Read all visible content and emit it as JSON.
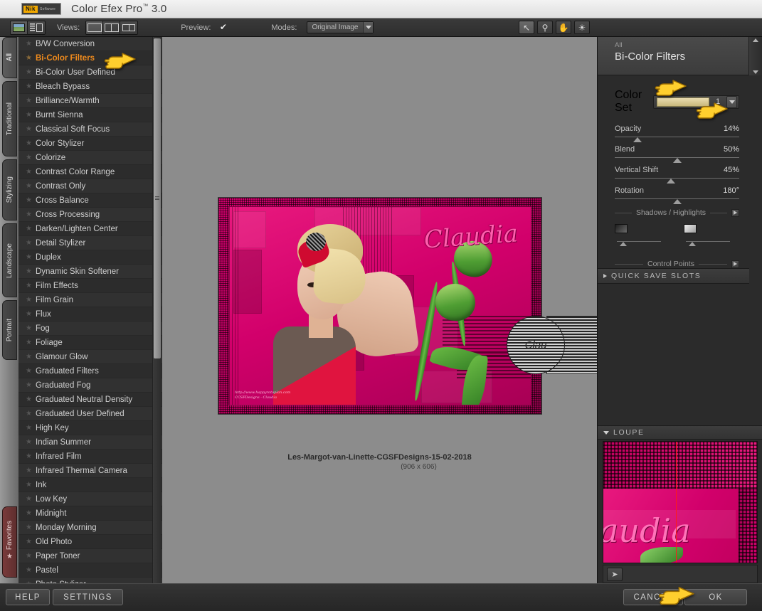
{
  "window": {
    "title": "Color Efex Pro",
    "trademark": "™",
    "version": "3.0",
    "logo_mark": "Nik",
    "logo_sub": "Software"
  },
  "toolbar": {
    "views_label": "Views:",
    "preview_label": "Preview:",
    "preview_checked_glyph": "✔",
    "modes_label": "Modes:",
    "modes_value": "Original Image",
    "view_icons": [
      "image-view-icon",
      "list-view-icon"
    ],
    "view_modes": [
      "single-view-icon",
      "split-view-icon",
      "side-by-side-view-icon"
    ],
    "tools": [
      {
        "name": "cursor-tool",
        "glyph": "↖"
      },
      {
        "name": "zoom-tool",
        "glyph": "⚲"
      },
      {
        "name": "pan-hand-tool",
        "glyph": "✋"
      },
      {
        "name": "brightness-tool",
        "glyph": "☀"
      }
    ]
  },
  "category_tabs": [
    {
      "label": "All",
      "selected": true
    },
    {
      "label": "Traditional",
      "selected": false
    },
    {
      "label": "Stylizing",
      "selected": false
    },
    {
      "label": "Landscape",
      "selected": false
    },
    {
      "label": "Portrait",
      "selected": false
    }
  ],
  "favorites_tab": {
    "label": "Favorites",
    "star_glyph": "★"
  },
  "filters": [
    {
      "label": "B/W Conversion",
      "selected": false
    },
    {
      "label": "Bi-Color Filters",
      "selected": true
    },
    {
      "label": "Bi-Color User Defined",
      "selected": false
    },
    {
      "label": "Bleach Bypass",
      "selected": false
    },
    {
      "label": "Brilliance/Warmth",
      "selected": false
    },
    {
      "label": "Burnt Sienna",
      "selected": false
    },
    {
      "label": "Classical Soft Focus",
      "selected": false
    },
    {
      "label": "Color Stylizer",
      "selected": false
    },
    {
      "label": "Colorize",
      "selected": false
    },
    {
      "label": "Contrast Color Range",
      "selected": false
    },
    {
      "label": "Contrast Only",
      "selected": false
    },
    {
      "label": "Cross Balance",
      "selected": false
    },
    {
      "label": "Cross Processing",
      "selected": false
    },
    {
      "label": "Darken/Lighten Center",
      "selected": false
    },
    {
      "label": "Detail Stylizer",
      "selected": false
    },
    {
      "label": "Duplex",
      "selected": false
    },
    {
      "label": "Dynamic Skin Softener",
      "selected": false
    },
    {
      "label": "Film Effects",
      "selected": false
    },
    {
      "label": "Film Grain",
      "selected": false
    },
    {
      "label": "Flux",
      "selected": false
    },
    {
      "label": "Fog",
      "selected": false
    },
    {
      "label": "Foliage",
      "selected": false
    },
    {
      "label": "Glamour Glow",
      "selected": false
    },
    {
      "label": "Graduated Filters",
      "selected": false
    },
    {
      "label": "Graduated Fog",
      "selected": false
    },
    {
      "label": "Graduated Neutral Density",
      "selected": false
    },
    {
      "label": "Graduated User Defined",
      "selected": false
    },
    {
      "label": "High Key",
      "selected": false
    },
    {
      "label": "Indian Summer",
      "selected": false
    },
    {
      "label": "Infrared Film",
      "selected": false
    },
    {
      "label": "Infrared Thermal Camera",
      "selected": false
    },
    {
      "label": "Ink",
      "selected": false
    },
    {
      "label": "Low Key",
      "selected": false
    },
    {
      "label": "Midnight",
      "selected": false
    },
    {
      "label": "Monday Morning",
      "selected": false
    },
    {
      "label": "Old Photo",
      "selected": false
    },
    {
      "label": "Paper Toner",
      "selected": false
    },
    {
      "label": "Pastel",
      "selected": false
    },
    {
      "label": "Photo Stylizer",
      "selected": false
    }
  ],
  "canvas": {
    "image_caption": "Les-Margot-van-Linette-CGSFDesigns-15-02-2018",
    "image_dimensions": "(906 x 606)",
    "artwork": {
      "script_text": "Claudia",
      "watermark_line1": "http://www.happyrotoplan.com",
      "watermark_line2": "CCSFDesigns - Claudia",
      "stamp_text": "Clau"
    }
  },
  "panel": {
    "category": "All",
    "title": "Bi-Color Filters",
    "color_set": {
      "label": "Color Set",
      "value": "1"
    },
    "sliders": [
      {
        "label": "Opacity",
        "value": "14%",
        "pos_pct": 18
      },
      {
        "label": "Blend",
        "value": "50%",
        "pos_pct": 50
      },
      {
        "label": "Vertical Shift",
        "value": "45%",
        "pos_pct": 45
      },
      {
        "label": "Rotation",
        "value": "180°",
        "pos_pct": 50
      }
    ],
    "shadows_highlights": {
      "title": "Shadows / Highlights",
      "shadow_pos_pct": 8,
      "highlight_pos_pct": 8
    },
    "control_points": {
      "title": "Control Points",
      "remove_glyph": "—",
      "add_glyph": "➕"
    },
    "quick_save_slots": {
      "label": "QUICK SAVE SLOTS",
      "expanded": false
    },
    "loupe": {
      "label": "LOUPE",
      "expanded": true,
      "pin_glyph": "➤"
    }
  },
  "bottom_bar": {
    "help": "HELP",
    "settings": "SETTINGS",
    "cancel": "CANCEL",
    "ok": "OK"
  },
  "colors": {
    "accent_orange": "#f08b1d",
    "cursor_yellow": "#ffcf2e",
    "panel_bg": "#2b2b2b",
    "canvas_bg": "#8c8c8c",
    "crosshair_red": "#ff1a1a"
  }
}
